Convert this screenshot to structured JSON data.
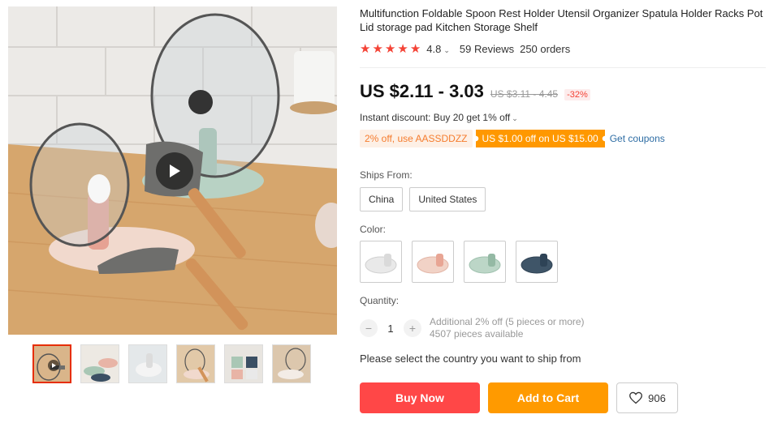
{
  "product": {
    "title": "Multifunction Foldable Spoon Rest Holder Utensil Organizer Spatula Holder Racks Pot Lid storage pad Kitchen Storage Shelf",
    "rating": "4.8",
    "reviews": "59 Reviews",
    "orders": "250 orders",
    "price": "US $2.11 - 3.03",
    "price_original": "US $3.11 - 4.45",
    "discount": "-32%"
  },
  "promotions": {
    "instant_discount": "Instant discount: Buy 20 get 1% off",
    "coupon_code": "2% off, use AASSDDZZ",
    "coupon_offer": "US $1.00 off on US $15.00",
    "get_coupons": "Get coupons"
  },
  "shipping": {
    "label": "Ships From:",
    "options": [
      "China",
      "United States"
    ]
  },
  "color": {
    "label": "Color:",
    "swatches": [
      {
        "name": "white",
        "hex": "#e9e9e9"
      },
      {
        "name": "pink",
        "hex": "#e8b4a6"
      },
      {
        "name": "green",
        "hex": "#a9c7b5"
      },
      {
        "name": "navy",
        "hex": "#3a4f63"
      }
    ]
  },
  "quantity": {
    "label": "Quantity:",
    "value": "1",
    "minus": "−",
    "plus": "+",
    "additional": "Additional 2% off (5 pieces or more)",
    "available": "4507 pieces available"
  },
  "select_country_note": "Please select the country you want to ship from",
  "actions": {
    "buy_now": "Buy Now",
    "add_to_cart": "Add to Cart",
    "wishlist_count": "906"
  },
  "icons": {
    "star": "star-icon",
    "play": "play-icon",
    "heart": "heart-icon",
    "chevron": "chevron-down-icon"
  },
  "colors": {
    "price_red": "#f44336",
    "buy_now": "#ff4747",
    "add_to_cart": "#ff9a00",
    "link_blue": "#2e6da4"
  }
}
